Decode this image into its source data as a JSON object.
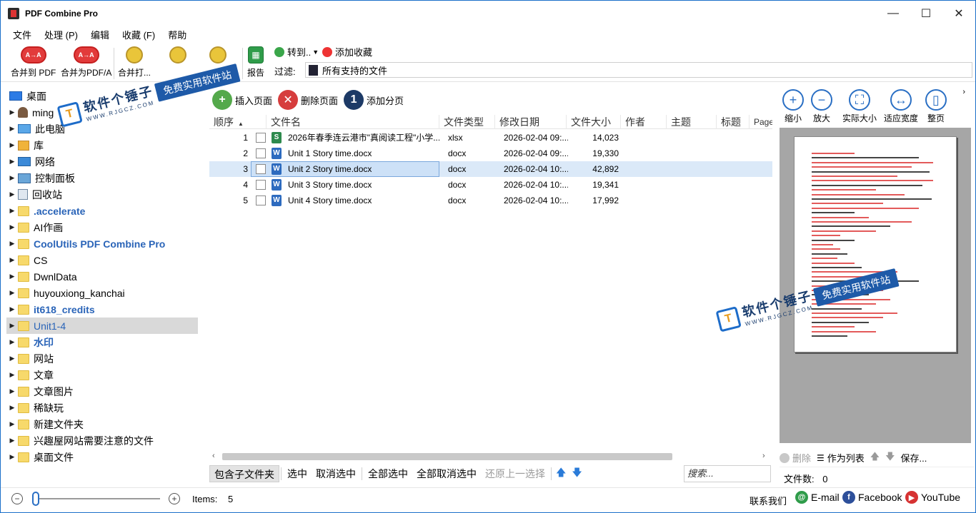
{
  "window": {
    "title": "PDF Combine Pro",
    "minimize": "—",
    "maximize": "☐",
    "close": "✕"
  },
  "menu": [
    "文件",
    "处理 (P)",
    "编辑",
    "收藏 (F)",
    "帮助"
  ],
  "toolbar": {
    "merge_pdf": "合并到 PDF",
    "merge_pdfa": "合并为PDF/A",
    "merge_more": "合并打...",
    "report": "报告",
    "goto": "转到..",
    "add_favorite": "添加收藏",
    "filter_label": "过滤:",
    "filter_value": "所有支持的文件",
    "pdf_badge": "A→A"
  },
  "tree": [
    {
      "label": "桌面",
      "icon": "desktop-icon",
      "root": true
    },
    {
      "label": "ming",
      "icon": "user-icon"
    },
    {
      "label": "此电脑",
      "icon": "computer-icon"
    },
    {
      "label": "库",
      "icon": "library-icon"
    },
    {
      "label": "网络",
      "icon": "network-icon"
    },
    {
      "label": "控制面板",
      "icon": "control-panel-icon"
    },
    {
      "label": "回收站",
      "icon": "recycle-bin-icon"
    },
    {
      "label": ".accelerate",
      "icon": "folder-icon",
      "style": "blue"
    },
    {
      "label": "AI作画",
      "icon": "folder-icon"
    },
    {
      "label": "CoolUtils PDF Combine Pro",
      "icon": "folder-icon",
      "style": "blue"
    },
    {
      "label": "CS",
      "icon": "folder-icon"
    },
    {
      "label": "DwnlData",
      "icon": "folder-icon"
    },
    {
      "label": "huyouxiong_kanchai",
      "icon": "folder-icon"
    },
    {
      "label": "it618_credits",
      "icon": "folder-icon",
      "style": "blue"
    },
    {
      "label": "Unit1-4",
      "icon": "folder-icon",
      "style": "blue2",
      "selected": true
    },
    {
      "label": "水印",
      "icon": "folder-icon",
      "style": "blue"
    },
    {
      "label": "网站",
      "icon": "folder-icon"
    },
    {
      "label": "文章",
      "icon": "folder-icon"
    },
    {
      "label": "文章图片",
      "icon": "folder-icon"
    },
    {
      "label": "稀缺玩",
      "icon": "folder-icon"
    },
    {
      "label": "新建文件夹",
      "icon": "folder-icon"
    },
    {
      "label": "兴趣屋网站需要注意的文件",
      "icon": "folder-icon"
    },
    {
      "label": "桌面文件",
      "icon": "folder-icon"
    }
  ],
  "page_actions": {
    "insert": "插入页面",
    "delete": "删除页面",
    "add_break": "添加分页",
    "break_badge": "1"
  },
  "table": {
    "columns": [
      "顺序",
      "文件名",
      "文件类型",
      "修改日期",
      "文件大小",
      "作者",
      "主题",
      "标题",
      "Page"
    ],
    "sort_indicator": "▲",
    "rows": [
      {
        "order": "1",
        "name": "2026年春季连云港市\"真阅读工程\"小学...",
        "type": "xlsx",
        "date": "2026-02-04 09:...",
        "size": "14,023",
        "kind": "xl"
      },
      {
        "order": "2",
        "name": "Unit 1 Story time.docx",
        "type": "docx",
        "date": "2026-02-04 09:...",
        "size": "19,330",
        "kind": "wd"
      },
      {
        "order": "3",
        "name": "Unit 2 Story time.docx",
        "type": "docx",
        "date": "2026-02-04 10:...",
        "size": "42,892",
        "kind": "wd",
        "selected": true
      },
      {
        "order": "4",
        "name": "Unit 3 Story time.docx",
        "type": "docx",
        "date": "2026-02-04 10:...",
        "size": "19,341",
        "kind": "wd"
      },
      {
        "order": "5",
        "name": "Unit 4 Story time.docx",
        "type": "docx",
        "date": "2026-02-04 10:...",
        "size": "17,992",
        "kind": "wd"
      }
    ]
  },
  "midbar": {
    "include_subfolders": "包含子文件夹",
    "select": "选中",
    "deselect": "取消选中",
    "select_all": "全部选中",
    "deselect_all": "全部取消选中",
    "restore": "还原上一选择",
    "search_placeholder": "搜索..."
  },
  "preview": {
    "zoom_out": "缩小",
    "zoom_in": "放大",
    "actual_size": "实际大小",
    "fit_width": "适应宽度",
    "fit_page": "整页",
    "delete": "删除",
    "as_list": "作为列表",
    "save": "保存...",
    "file_count_label": "文件数:",
    "file_count": "0"
  },
  "status": {
    "items_label": "Items:",
    "items_value": "5",
    "contact": "联系我们",
    "email": "E-mail",
    "facebook": "Facebook",
    "youtube": "YouTube"
  },
  "watermark": {
    "main": "软件个锤子",
    "sub": "WWW.RJGCZ.COM",
    "tag": "免费实用软件站"
  },
  "colors": {
    "accent": "#1a6fc9",
    "selection": "#dbe9f8",
    "folder": "#f7d96b",
    "danger": "#e23b3b"
  }
}
